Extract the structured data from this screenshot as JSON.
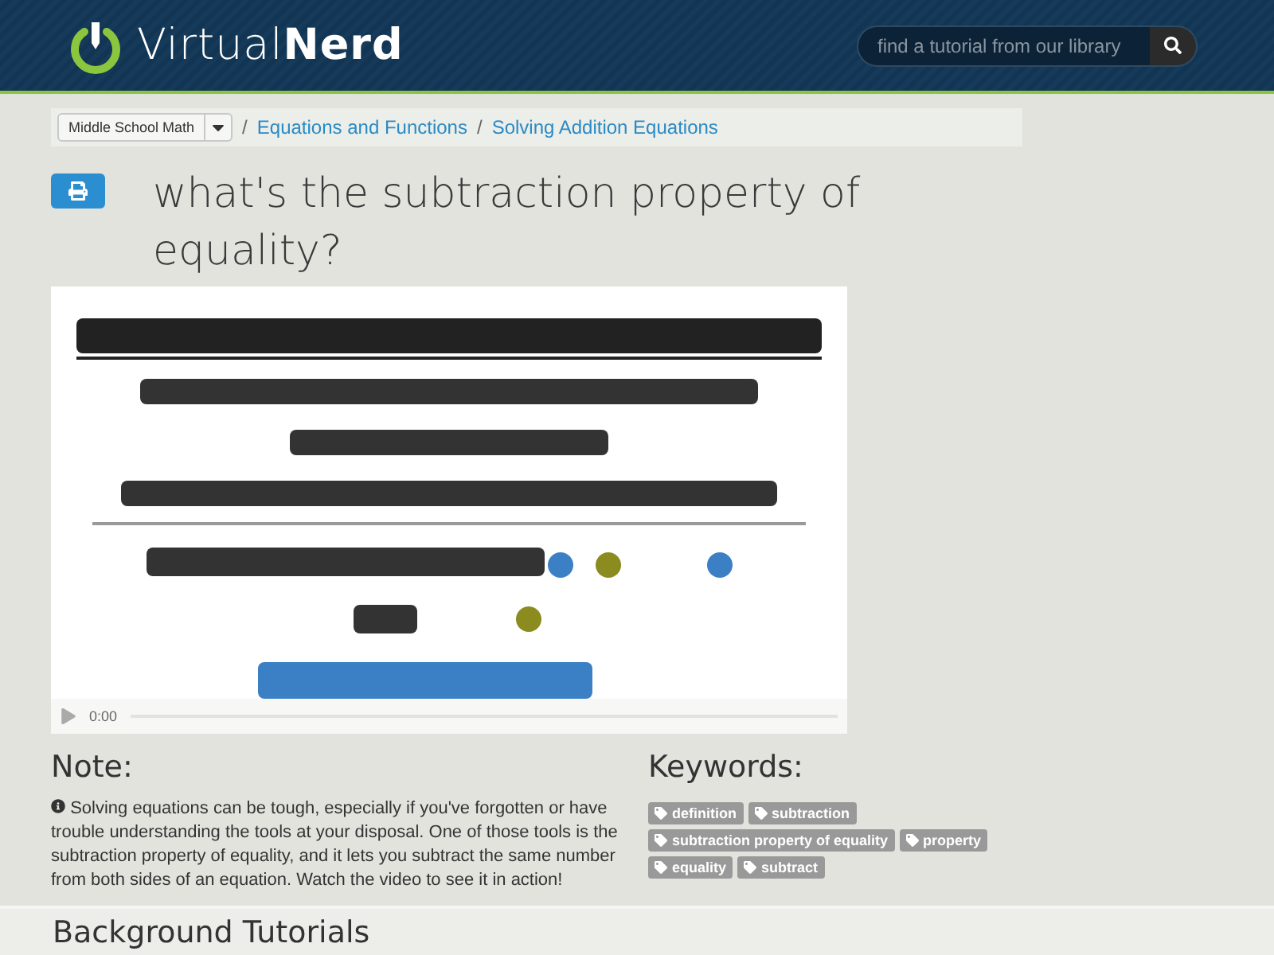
{
  "header": {
    "logo": {
      "light": "Virtual",
      "bold": "Nerd"
    },
    "search": {
      "placeholder": "find a tutorial from our library"
    }
  },
  "breadcrumb": {
    "subject": "Middle School Math",
    "links": [
      "Equations and Functions",
      "Solving Addition Equations"
    ],
    "separator": "/"
  },
  "title": "what's the subtraction property of equality?",
  "video": {
    "time": "0:00"
  },
  "note": {
    "heading": "Note:",
    "text": "Solving equations can be tough, especially if you've forgotten or have trouble understanding the tools at your disposal. One of those tools is the subtraction property of equality, and it lets you subtract the same number from both sides of an equation. Watch the video to see it in action!"
  },
  "keywords": {
    "heading": "Keywords:",
    "tags": [
      "definition",
      "subtraction",
      "subtraction property of equality",
      "property",
      "equality",
      "subtract"
    ]
  },
  "background": {
    "heading": "Background Tutorials"
  }
}
